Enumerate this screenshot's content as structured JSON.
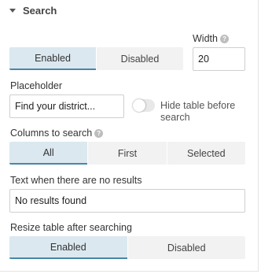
{
  "section": {
    "title": "Search",
    "icon": "chevron-down-icon"
  },
  "width": {
    "label": "Width",
    "value": "20",
    "help_icon": "help-icon"
  },
  "enabled_toggle": {
    "options": [
      "Enabled",
      "Disabled"
    ],
    "selected": "Enabled"
  },
  "placeholder": {
    "label": "Placeholder",
    "value": "Find your district..."
  },
  "hide_table": {
    "label_line1": "Hide table before",
    "label_line2": "search",
    "on": false
  },
  "columns": {
    "label": "Columns to search",
    "help_icon": "help-icon",
    "options": [
      "All",
      "First",
      "Selected"
    ],
    "selected": "All"
  },
  "no_results": {
    "label": "Text when there are no results",
    "value": "No results found"
  },
  "resize": {
    "label": "Resize table after searching",
    "options": [
      "Enabled",
      "Disabled"
    ],
    "selected": "Enabled"
  },
  "colors": {
    "active_bg": "#dbe8ef",
    "active_border": "#4a86a8",
    "inactive_bg": "#f2f2f2"
  }
}
